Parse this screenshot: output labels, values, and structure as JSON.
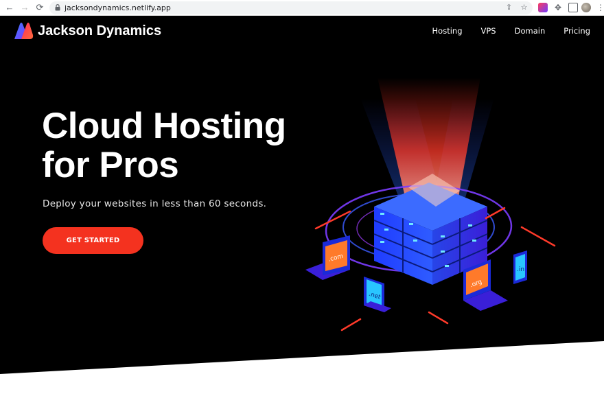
{
  "browser": {
    "url": "jacksondynamics.netlify.app",
    "back_icon": "arrow-left-icon",
    "forward_icon": "arrow-right-icon",
    "reload_icon": "reload-icon"
  },
  "site": {
    "brand": "Jackson Dynamics",
    "nav": [
      {
        "label": "Hosting"
      },
      {
        "label": "VPS"
      },
      {
        "label": "Domain"
      },
      {
        "label": "Pricing"
      }
    ],
    "hero": {
      "title_line1": "Cloud Hosting",
      "title_line2": "for Pros",
      "subtitle": "Deploy your websites in less than 60 seconds.",
      "cta_label": "GET STARTED"
    },
    "illustration_labels": {
      "com": ".com",
      "net": ".net",
      "org": ".org",
      "in": ".in"
    }
  },
  "colors": {
    "hero_bg": "#000000",
    "accent": "#f4321f",
    "server_blue": "#2b5bff",
    "purple": "#7b3cff"
  }
}
